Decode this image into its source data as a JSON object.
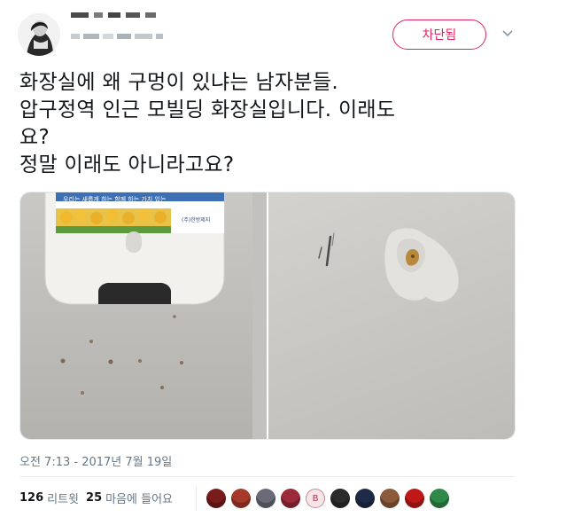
{
  "author": {
    "display_name": "",
    "handle": ""
  },
  "follow_button": {
    "label": "차단됨",
    "color": "#e0245e"
  },
  "tweet": {
    "lines": [
      "화장실에 왜 구멍이 있냐는 남자분들.",
      "압구정역 인근 모빌딩 화장실입니다. 이래도",
      "요?",
      "정말 이래도 아니라고요?"
    ]
  },
  "media": {
    "sign_text": "우리는 새롭게 하는 함께 하는 가치 있는",
    "sign_brand": "(주)한방제지"
  },
  "timestamp": "오전 7:13 - 2017년 7월 19일",
  "stats": {
    "retweets_count": "126",
    "retweets_label": "리트윗",
    "likes_count": "25",
    "likes_label": "마음에 들어요"
  },
  "likers": [
    {
      "icon": "avatar",
      "color": "#7a1b1b"
    },
    {
      "icon": "avatar",
      "color": "#a63a2a"
    },
    {
      "icon": "avatar",
      "color": "#6b6b78"
    },
    {
      "icon": "avatar",
      "color": "#9b2a3a"
    },
    {
      "icon": "avatar-b",
      "color": "#f3e5e8",
      "letter": "B"
    },
    {
      "icon": "avatar",
      "color": "#2b2b2b"
    },
    {
      "icon": "avatar",
      "color": "#1f2a48"
    },
    {
      "icon": "avatar",
      "color": "#8b5a3a"
    },
    {
      "icon": "avatar",
      "color": "#c01818"
    },
    {
      "icon": "avatar",
      "color": "#2f8a4a"
    }
  ]
}
